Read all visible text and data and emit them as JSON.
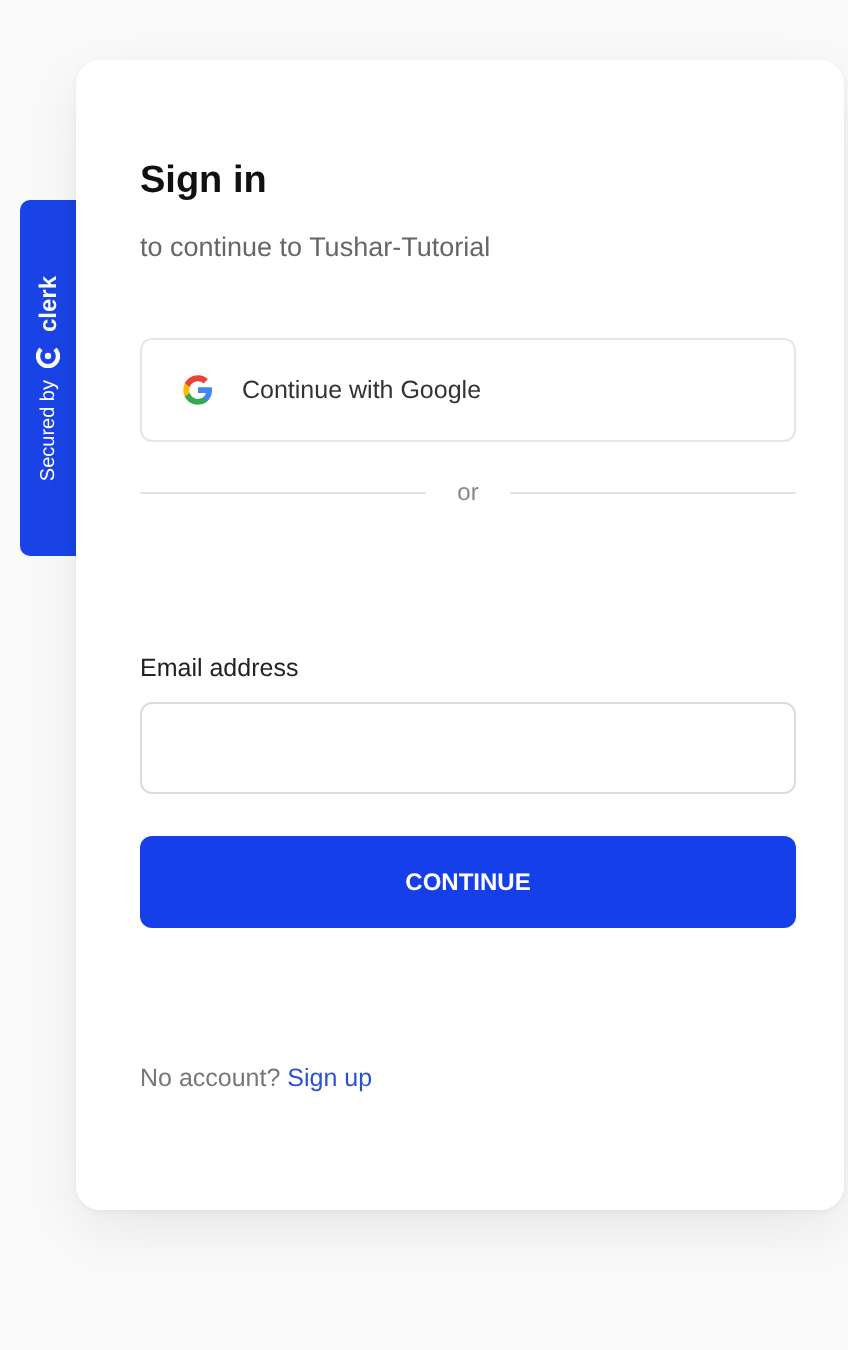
{
  "badge": {
    "prefix": "Secured by",
    "brand": "clerk"
  },
  "title": "Sign in",
  "subtitle": "to continue to Tushar-Tutorial",
  "social_button": {
    "label": "Continue with Google"
  },
  "divider": {
    "label": "or"
  },
  "email": {
    "label": "Email address"
  },
  "primary_button": {
    "label": "CONTINUE"
  },
  "footer": {
    "text": "No account?",
    "link": "Sign up"
  }
}
